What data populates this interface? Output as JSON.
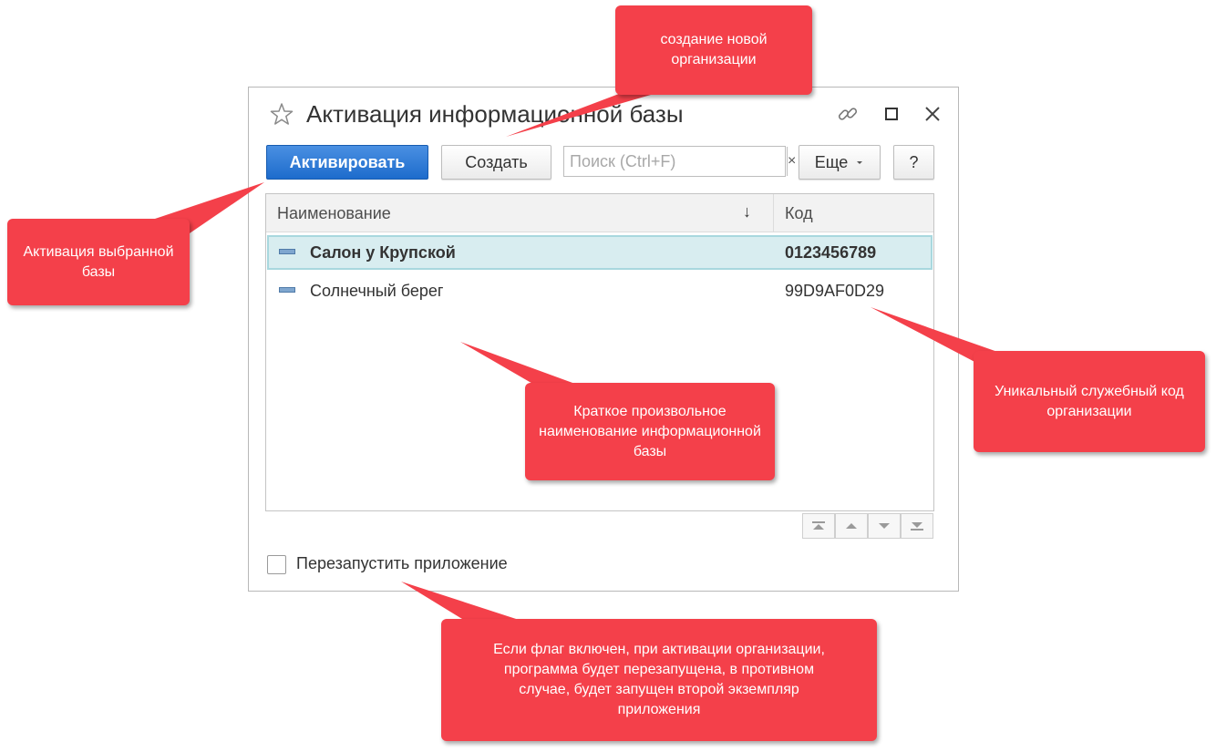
{
  "window": {
    "title": "Активация информационной базы",
    "icons": [
      "star-icon",
      "link-icon",
      "maximize-icon",
      "close-icon"
    ]
  },
  "toolbar": {
    "activate_label": "Активировать",
    "create_label": "Создать",
    "search_placeholder": "Поиск (Ctrl+F)",
    "search_clear": "×",
    "more_label": "Еще",
    "help_label": "?"
  },
  "table": {
    "columns": [
      "Наименование",
      "Код"
    ],
    "rows": [
      {
        "name": "Салон у Крупской",
        "code": "0123456789",
        "selected": true
      },
      {
        "name": "Солнечный берег",
        "code": "99D9AF0D29",
        "selected": false
      }
    ],
    "nav_icons": [
      "move-first-icon",
      "move-up-icon",
      "move-down-icon",
      "move-last-icon"
    ]
  },
  "restart": {
    "label": "Перезапустить приложение",
    "checked": false
  },
  "callouts": {
    "create": "создание новой организации",
    "activate": "Активация выбранной базы",
    "name": "Краткое произвольное наименование информационной базы",
    "code": "Уникальный служебный код организации",
    "restart": "Если флаг включен, при активации организации, программа будет перезапущена, в противном случае, будет запущен второй экземпляр приложения"
  },
  "colors": {
    "callout": "#f4404a",
    "primary_button": "#1d6ccc",
    "selected_row": "#d8edf0"
  }
}
